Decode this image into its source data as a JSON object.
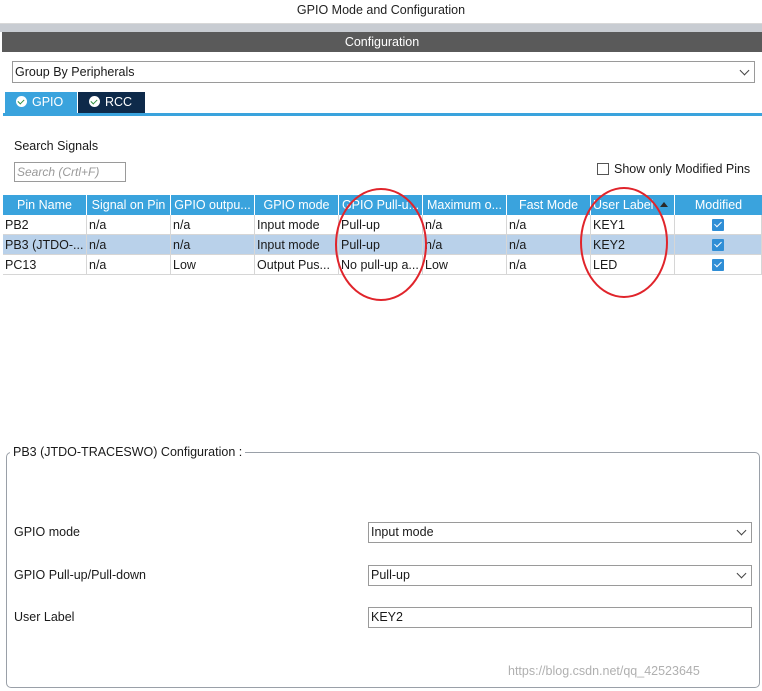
{
  "window": {
    "title": "GPIO Mode and Configuration"
  },
  "config_header": "Configuration",
  "group_select": {
    "value": "Group By Peripherals"
  },
  "tabs": [
    {
      "label": "GPIO",
      "active": true
    },
    {
      "label": "RCC",
      "active": false
    }
  ],
  "search": {
    "label": "Search Signals",
    "placeholder": "Search (Crtl+F)"
  },
  "only_modified": {
    "label": "Show only Modified Pins",
    "checked": false
  },
  "table": {
    "columns": [
      "Pin Name",
      "Signal on Pin",
      "GPIO outpu...",
      "GPIO mode",
      "GPIO Pull-u...",
      "Maximum o...",
      "Fast Mode",
      "User Label",
      "Modified"
    ],
    "rows": [
      {
        "cells": [
          "PB2",
          "n/a",
          "n/a",
          "Input mode",
          "Pull-up",
          "n/a",
          "n/a",
          "KEY1"
        ],
        "modified": true,
        "selected": false
      },
      {
        "cells": [
          "PB3 (JTDO-...",
          "n/a",
          "n/a",
          "Input mode",
          "Pull-up",
          "n/a",
          "n/a",
          "KEY2"
        ],
        "modified": true,
        "selected": true
      },
      {
        "cells": [
          "PC13",
          "n/a",
          "Low",
          "Output Pus...",
          "No pull-up a...",
          "Low",
          "n/a",
          "LED"
        ],
        "modified": true,
        "selected": false
      }
    ]
  },
  "annotation_color": "#e0242b",
  "pin_config": {
    "title": "PB3 (JTDO-TRACESWO) Configuration :",
    "gpio_mode": {
      "label": "GPIO mode",
      "value": "Input mode"
    },
    "pull": {
      "label": "GPIO Pull-up/Pull-down",
      "value": "Pull-up"
    },
    "user_label": {
      "label": "User Label",
      "value": "KEY2"
    }
  },
  "watermark": "https://blog.csdn.net/qq_42523645"
}
